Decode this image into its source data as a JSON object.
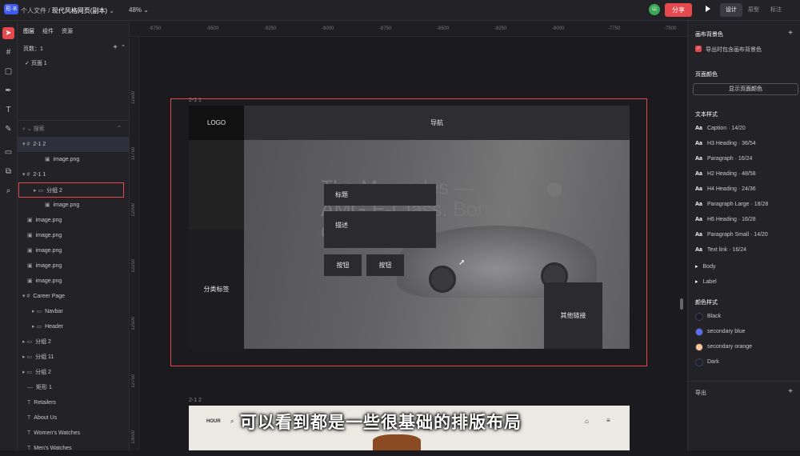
{
  "topbar": {
    "logo_text": "形·B",
    "crumb_root": "个人文件",
    "crumb_sep": "/",
    "crumb_file": "现代风格网页(副本)",
    "zoom": "48%",
    "avatar": "山",
    "share": "分享",
    "modes": [
      "设计",
      "原型",
      "标注"
    ]
  },
  "left": {
    "tabs": [
      "图层",
      "组件",
      "资源"
    ],
    "pages_label": "页数：1",
    "page_item": "页面 1",
    "search_placeholder": "搜索",
    "layers": [
      {
        "label": "2-1 2"
      },
      {
        "label": "image.png"
      },
      {
        "label": "2-1 1"
      },
      {
        "label": "分组 2"
      },
      {
        "label": "image.png"
      },
      {
        "label": "image.png"
      },
      {
        "label": "image.png"
      },
      {
        "label": "image.png"
      },
      {
        "label": "image.png"
      },
      {
        "label": "image.png"
      },
      {
        "label": "Career Page"
      },
      {
        "label": "Navbar"
      },
      {
        "label": "Header"
      },
      {
        "label": "分组 2"
      },
      {
        "label": "分组 11"
      },
      {
        "label": "分组 2"
      },
      {
        "label": "矩形 1"
      },
      {
        "label": "Retailers"
      },
      {
        "label": "About Us"
      },
      {
        "label": "Women's Watches"
      },
      {
        "label": "Men's Watches"
      }
    ]
  },
  "rulers": {
    "top": [
      "-9750",
      "-9500",
      "-9250",
      "-9000",
      "-8750",
      "-8500",
      "-8250",
      "-8000",
      "-7750",
      "-7500"
    ],
    "left": [
      "11500",
      "11750",
      "12000",
      "12250",
      "12500",
      "12750",
      "13000"
    ]
  },
  "canvas": {
    "frame1_label": "2-1 1",
    "frame2_label": "2-1 2",
    "hero_title": "The Mercedes — AMG E-Class. Born on the circuit.",
    "overlay": {
      "logo": "LOGO",
      "nav": "导航",
      "title": "标题",
      "desc": "描述",
      "btn1": "按钮",
      "btn2": "按钮",
      "category": "分类标签",
      "other": "其他链接"
    },
    "frame2_brand": "HOUR",
    "caption": "可以看到都是一些很基础的排版布局"
  },
  "right": {
    "canvas_bg": "画布背景色",
    "export_bg": "导出时包含画布背景色",
    "page_color": "页面颜色",
    "show_page_color": "显示页面颜色",
    "text_styles_title": "文本样式",
    "text_styles": [
      "Caption · 14/20",
      "H3 Heading · 36/54",
      "Paragraph · 16/24",
      "H2 Heading · 48/58",
      "H4 Heading · 24/36",
      "Paragraph Large · 18/28",
      "H6 Heading · 16/28",
      "Paragraph Small · 14/20",
      "Text link · 16/24"
    ],
    "groups": [
      "Body",
      "Label"
    ],
    "colors_title": "颜色样式",
    "colors": [
      {
        "name": "Black",
        "hex": "#1a1a2e"
      },
      {
        "name": "secondary blue",
        "hex": "#5b6cff"
      },
      {
        "name": "secondary orange",
        "hex": "#ffc89a"
      },
      {
        "name": "Dark",
        "hex": "#1c1f33"
      }
    ],
    "export": "导出"
  }
}
